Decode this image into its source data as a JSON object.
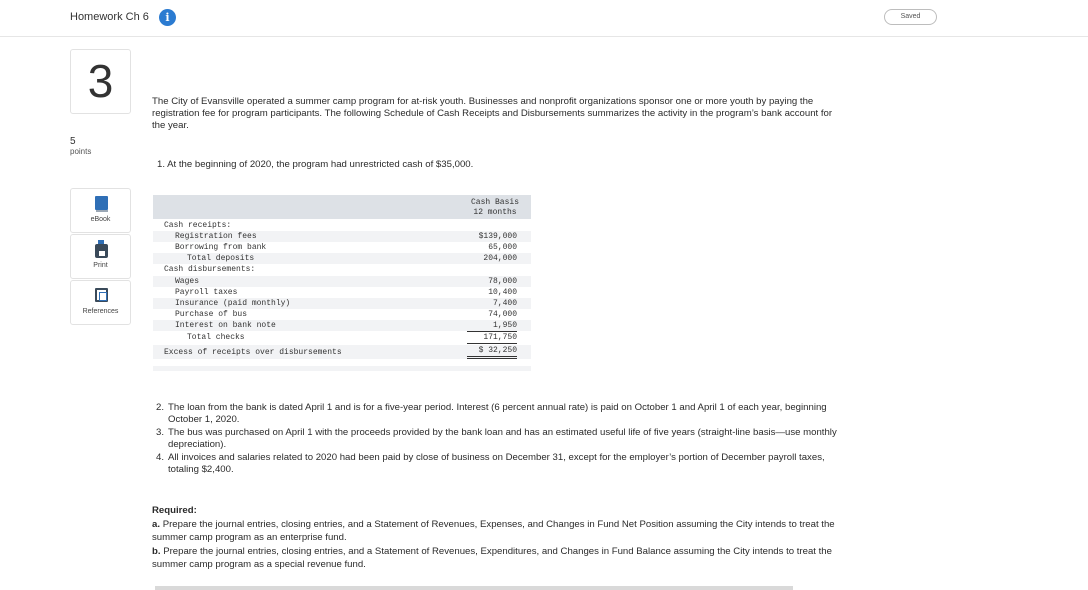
{
  "header": {
    "title": "Homework Ch 6",
    "info_icon": "info-icon",
    "info_glyph": "i",
    "saved_label": "Saved"
  },
  "question": {
    "number": "3",
    "points_value": "5",
    "points_label": "points"
  },
  "sidebar": {
    "items": [
      {
        "label": "eBook",
        "icon": "ebook-icon"
      },
      {
        "label": "Print",
        "icon": "print-icon"
      },
      {
        "label": "References",
        "icon": "references-icon"
      }
    ]
  },
  "problem": {
    "intro": "The City of Evansville operated a summer camp program for at-risk youth. Businesses and nonprofit organizations sponsor one or more youth by paying the registration fee for program participants. The following Schedule of Cash Receipts and Disbursements summarizes the activity in the program’s bank account for the year.",
    "item1": "1. At the beginning of 2020, the program had unrestricted cash of $35,000.",
    "items": [
      {
        "num": "2.",
        "text": "The loan from the bank is dated April 1 and is for a five-year period. Interest (6 percent annual rate) is paid on October 1 and April 1 of each year, beginning October 1, 2020."
      },
      {
        "num": "3.",
        "text": "The bus was purchased on April 1 with the proceeds provided by the bank loan and has an estimated useful life of five years (straight-line basis—use monthly depreciation)."
      },
      {
        "num": "4.",
        "text": "All invoices and salaries related to 2020 had been paid by close of business on December 31, except for the employer’s portion of December payroll taxes, totaling $2,400."
      }
    ],
    "required_heading": "Required:",
    "req_a_prefix": "a.",
    "req_a": "Prepare the journal entries, closing entries, and a Statement of Revenues, Expenses, and Changes in Fund Net Position assuming the City intends to treat the summer camp program as an enterprise fund.",
    "req_b_prefix": "b.",
    "req_b": "Prepare the journal entries, closing entries, and a Statement of Revenues, Expenditures, and Changes in Fund Balance assuming the City intends to treat the summer camp program as a special revenue fund."
  },
  "schedule": {
    "col_head_1": "Cash Basis",
    "col_head_2": "12 months",
    "rows": [
      {
        "label": "Cash receipts:",
        "value": ""
      },
      {
        "label": "Registration fees",
        "value": "$139,000"
      },
      {
        "label": "Borrowing from bank",
        "value": "65,000"
      },
      {
        "label": "Total deposits",
        "value": "204,000"
      },
      {
        "label": "Cash disbursements:",
        "value": ""
      },
      {
        "label": "Wages",
        "value": "78,000"
      },
      {
        "label": "Payroll taxes",
        "value": "10,400"
      },
      {
        "label": "Insurance (paid monthly)",
        "value": "7,400"
      },
      {
        "label": "Purchase of bus",
        "value": "74,000"
      },
      {
        "label": "Interest on bank note",
        "value": "1,950"
      },
      {
        "label": "Total checks",
        "value": "171,750"
      },
      {
        "label": "Excess of receipts over disbursements",
        "value": "$ 32,250"
      }
    ]
  }
}
